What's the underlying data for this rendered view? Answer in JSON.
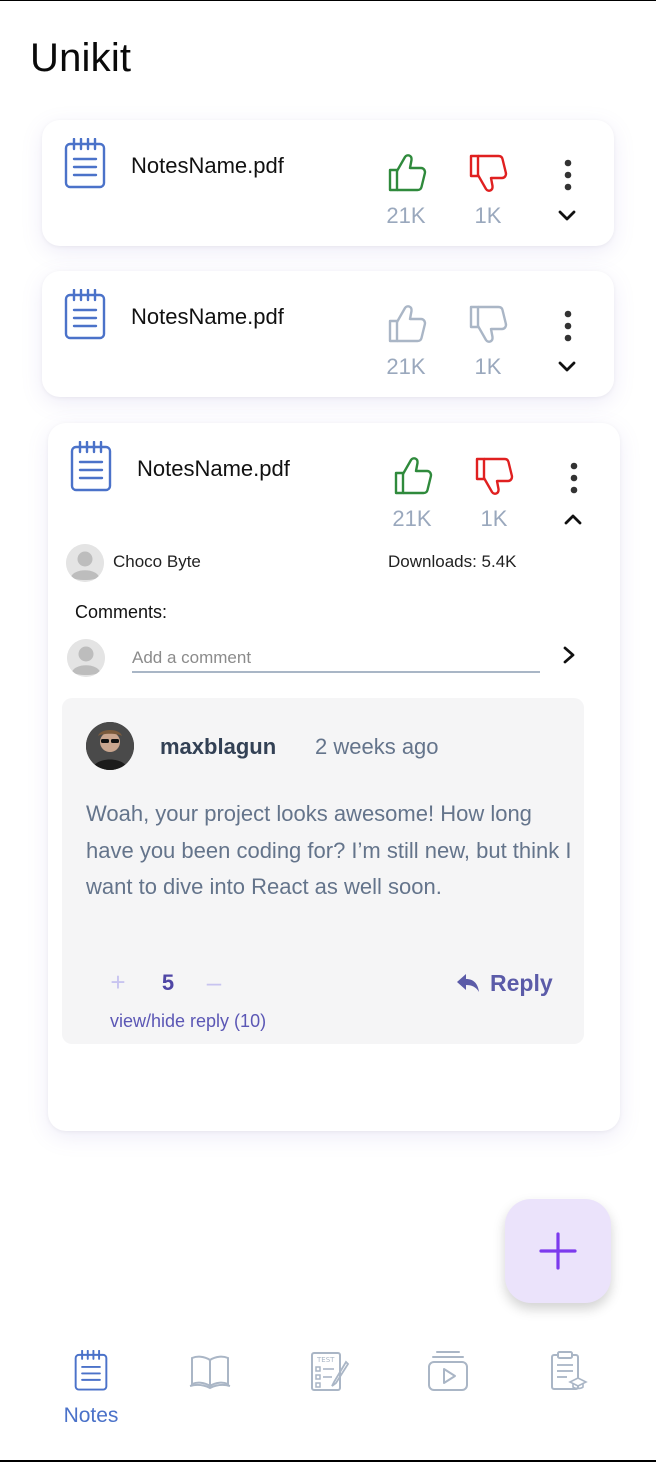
{
  "app": {
    "title": "Unikit"
  },
  "colors": {
    "like_active": "#2f8a3c",
    "dislike_active": "#e02020",
    "vote_inactive": "#aab6c6",
    "accent": "#4b72c9",
    "fab_bg": "#ebe3fb",
    "fab_plus": "#7c3aed"
  },
  "notes": [
    {
      "icon": "notepad-icon",
      "name": "NotesName.pdf",
      "likes": "21K",
      "dislikes": "1K",
      "vote_state": "active",
      "expanded": false
    },
    {
      "icon": "notepad-icon",
      "name": "NotesName.pdf",
      "likes": "21K",
      "dislikes": "1K",
      "vote_state": "inactive",
      "expanded": false
    },
    {
      "icon": "notepad-icon",
      "name": "NotesName.pdf",
      "likes": "21K",
      "dislikes": "1K",
      "vote_state": "active",
      "expanded": true,
      "author": "Choco Byte",
      "downloads": "Downloads: 5.4K",
      "comments_label": "Comments:",
      "comment_placeholder": "Add a comment",
      "comment": {
        "username": "maxblagun",
        "time_ago": "2 weeks ago",
        "text": "Woah, your project looks awesome! How long have you been coding for? I’m still new, but think I want to dive into React as well soon.",
        "score": "5",
        "plus_symbol": "+",
        "minus_symbol": "–",
        "reply_label": "Reply",
        "view_hide_label": "view/hide reply (10)"
      }
    }
  ],
  "fab": {
    "icon": "plus-icon"
  },
  "bottom_nav": [
    {
      "icon": "notes-icon",
      "label": "Notes",
      "active": true
    },
    {
      "icon": "book-icon",
      "label": "",
      "active": false
    },
    {
      "icon": "test-icon",
      "label": "",
      "active": false
    },
    {
      "icon": "video-icon",
      "label": "",
      "active": false
    },
    {
      "icon": "clipboard-icon",
      "label": "",
      "active": false
    }
  ]
}
